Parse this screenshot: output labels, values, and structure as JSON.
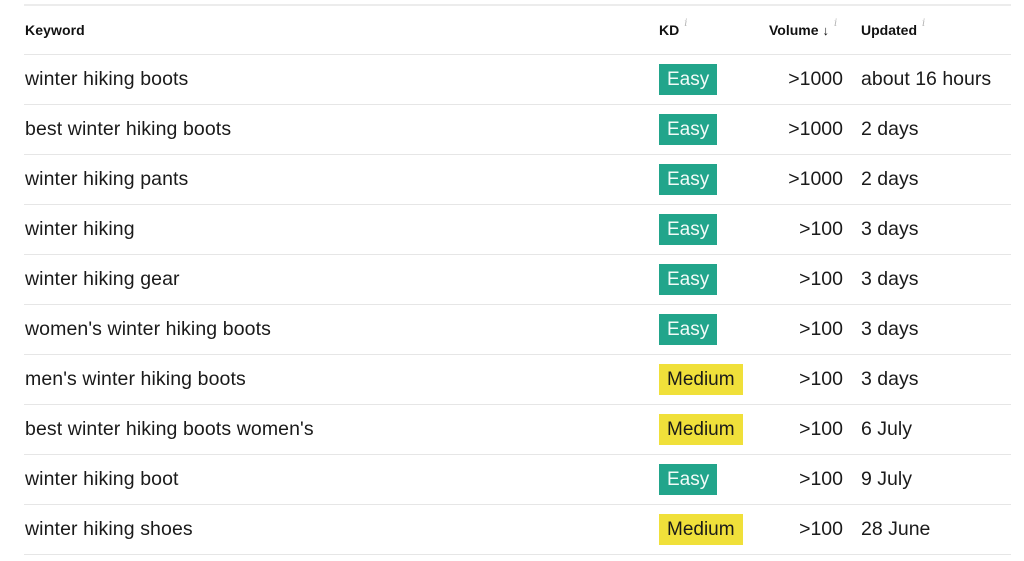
{
  "table": {
    "columns": {
      "keyword": "Keyword",
      "kd": "KD",
      "volume": "Volume",
      "updated": "Updated",
      "sort_icon": "arrow-down-icon",
      "info_icon": "info-icon",
      "info_glyph": "i",
      "sort_glyph": "↓"
    },
    "colors": {
      "easy": "#22a58b",
      "medium": "#f0e03a"
    },
    "rows": [
      {
        "keyword": "winter hiking boots",
        "kd": "Easy",
        "kd_level": "easy",
        "volume": ">1000",
        "updated": "about 16 hours"
      },
      {
        "keyword": "best winter hiking boots",
        "kd": "Easy",
        "kd_level": "easy",
        "volume": ">1000",
        "updated": "2 days"
      },
      {
        "keyword": "winter hiking pants",
        "kd": "Easy",
        "kd_level": "easy",
        "volume": ">1000",
        "updated": "2 days"
      },
      {
        "keyword": "winter hiking",
        "kd": "Easy",
        "kd_level": "easy",
        "volume": ">100",
        "updated": "3 days"
      },
      {
        "keyword": "winter hiking gear",
        "kd": "Easy",
        "kd_level": "easy",
        "volume": ">100",
        "updated": "3 days"
      },
      {
        "keyword": "women's winter hiking boots",
        "kd": "Easy",
        "kd_level": "easy",
        "volume": ">100",
        "updated": "3 days"
      },
      {
        "keyword": "men's winter hiking boots",
        "kd": "Medium",
        "kd_level": "medium",
        "volume": ">100",
        "updated": "3 days"
      },
      {
        "keyword": "best winter hiking boots women's",
        "kd": "Medium",
        "kd_level": "medium",
        "volume": ">100",
        "updated": "6 July"
      },
      {
        "keyword": "winter hiking boot",
        "kd": "Easy",
        "kd_level": "easy",
        "volume": ">100",
        "updated": "9 July"
      },
      {
        "keyword": "winter hiking shoes",
        "kd": "Medium",
        "kd_level": "medium",
        "volume": ">100",
        "updated": "28 June"
      }
    ]
  }
}
